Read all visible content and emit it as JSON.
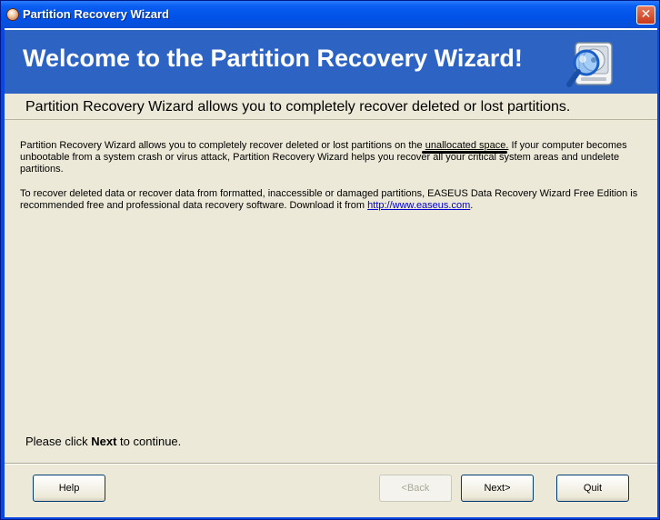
{
  "window": {
    "title": "Partition Recovery Wizard",
    "close_glyph": "✕",
    "icon": "app-disk-icon"
  },
  "banner": {
    "title": "Welcome to the Partition Recovery Wizard!",
    "icon": "disk-magnifier-icon"
  },
  "subtitle": "Partition Recovery Wizard allows you to completely recover deleted or lost partitions.",
  "paragraph1": {
    "before": "Partition Recovery Wizard allows you to completely recover deleted or lost partitions on the ",
    "underlined": "unallocated space.",
    "after": " If your computer becomes unbootable from a system crash or virus attack, Partition Recovery Wizard helps you recover all your critical system areas and undelete partitions."
  },
  "paragraph2": {
    "before": "To recover deleted data or recover data from formatted, inaccessible or damaged partitions, EASEUS Data Recovery Wizard Free Edition is recommended free and professional data recovery software. Download it from ",
    "link": "http://www.easeus.com",
    "after": "."
  },
  "continue": {
    "before": "Please click ",
    "bold": "Next",
    "after": " to continue."
  },
  "buttons": {
    "help": "Help",
    "back": "<Back",
    "next": "Next>",
    "quit": "Quit"
  },
  "colors": {
    "titlebar": "#0052e8",
    "banner": "#2d64c3",
    "client_bg": "#ece9d8",
    "link": "#0000cc"
  }
}
